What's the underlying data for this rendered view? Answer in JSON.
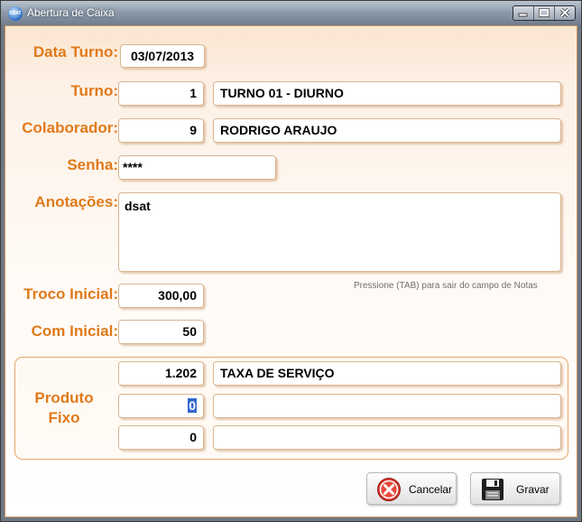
{
  "window": {
    "title": "Abertura de Caixa",
    "icon_text": "DSAT"
  },
  "title_controls": [
    "minimize-icon",
    "maximize-icon",
    "close-icon"
  ],
  "form": {
    "data_turno": {
      "label": "Data Turno:",
      "value": "03/07/2013"
    },
    "turno": {
      "label": "Turno:",
      "code": "1",
      "description": "TURNO 01 - DIURNO"
    },
    "colaborador": {
      "label": "Colaborador:",
      "code": "9",
      "name": "RODRIGO ARAUJO"
    },
    "senha": {
      "label": "Senha:",
      "value": "****"
    },
    "anotacoes": {
      "label": "Anotações:",
      "value": "dsat",
      "hint": "Pressione (TAB)  para sair do campo de Notas"
    },
    "troco_inicial": {
      "label": "Troco Inicial:",
      "value": "300,00"
    },
    "com_inicial": {
      "label": "Com Inicial:",
      "value": "50"
    }
  },
  "produto_fixo": {
    "label_line1": "Produto",
    "label_line2": "Fixo",
    "rows": [
      {
        "code": "1.202",
        "description": "TAXA DE SERVIÇO"
      },
      {
        "code": "0",
        "description": ""
      },
      {
        "code": "0",
        "description": ""
      }
    ]
  },
  "buttons": {
    "cancel": {
      "label": "Cancelar",
      "icon": "cancel-icon",
      "color": "#d9362b"
    },
    "save": {
      "label": "Gravar",
      "icon": "floppy-disk-icon"
    }
  },
  "colors": {
    "label": "#e07a1a",
    "background": "#fdf1e6",
    "border": "#e6a56b"
  }
}
